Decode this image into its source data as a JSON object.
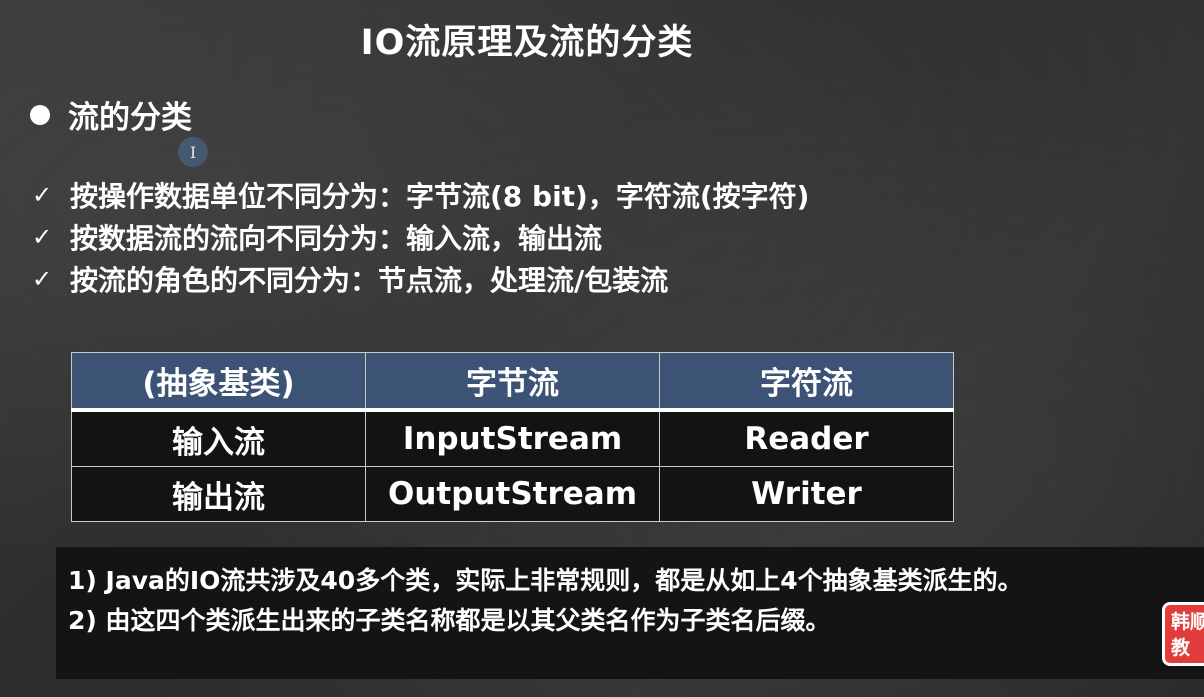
{
  "slide": {
    "title": "IO流原理及流的分类"
  },
  "section": {
    "bullet_text": "流的分类"
  },
  "classifications": [
    {
      "text": "按操作数据单位不同分为：字节流(8 bit)，字符流(按字符)"
    },
    {
      "text": "按数据流的流向不同分为：输入流，输出流"
    },
    {
      "text": "按流的角色的不同分为：节点流，处理流/包装流"
    }
  ],
  "check_symbol": "✓",
  "table": {
    "headers": [
      "(抽象基类)",
      "字节流",
      "字符流"
    ],
    "rows": [
      [
        "输入流",
        "InputStream",
        "Reader"
      ],
      [
        "输出流",
        "OutputStream",
        "Writer"
      ]
    ]
  },
  "notes": [
    "1) Java的IO流共涉及40多个类，实际上非常规则，都是从如上4个抽象基类派生的。",
    "2) 由这四个类派生出来的子类名称都是以其父类名作为子类名后缀。"
  ],
  "badge": {
    "line1": "韩顺",
    "line2": "教"
  },
  "cursor_glyph": "I",
  "colors": {
    "table_header_bg": "#3c5375",
    "table_body_bg": "#131313",
    "badge_bg": "#e03c3c"
  }
}
